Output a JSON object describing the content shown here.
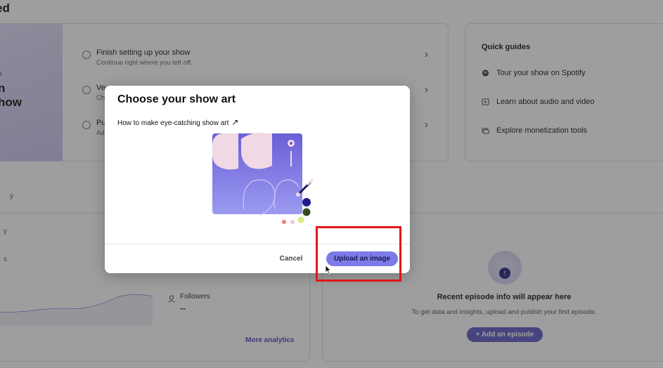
{
  "colors": {
    "accent": "#7c7be8",
    "accent_dark": "#2a2880",
    "highlight": "#e01818",
    "overlay": "rgba(40,40,40,0.45)"
  },
  "dashboard": {
    "page_title_fragment": "ed",
    "hero": {
      "small_fragment": "o",
      "big_line1": "n",
      "big_line2": "how"
    },
    "tasks": [
      {
        "title": "Finish setting up your show",
        "subtitle": "Continue right where you left off.",
        "chevron": "›"
      },
      {
        "title": "Ve",
        "subtitle": "Ch",
        "chevron": "›"
      },
      {
        "title": "Pu",
        "subtitle": "Ad",
        "chevron": "›"
      }
    ],
    "quick_guides": {
      "title": "Quick guides",
      "items": [
        {
          "label": "Tour your show on Spotify",
          "icon": "spotify-icon"
        },
        {
          "label": "Learn about audio and video",
          "icon": "play-square-icon"
        },
        {
          "label": "Explore monetization tools",
          "icon": "money-icon"
        }
      ]
    },
    "stats": {
      "left_fragment_1": "y",
      "left_fragment_2": "s",
      "followers_label": "Followers",
      "followers_value": "--",
      "more_analytics": "More analytics"
    },
    "episode": {
      "title": "Recent episode info will appear here",
      "subtitle": "To get data and insights, upload and publish your first episode.",
      "add_button": "+ Add an episode"
    }
  },
  "modal": {
    "title": "Choose your show art",
    "howto_link": "How to make eye-catching show art",
    "howto_arrow": "↗",
    "cancel_label": "Cancel",
    "upload_label": "Upload an image"
  }
}
